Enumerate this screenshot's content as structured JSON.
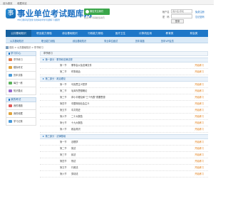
{
  "topbar": {
    "left": "设为首页",
    "right": "收藏本站"
  },
  "header": {
    "logo_glyph": "事",
    "title": "事业单位考试题库网",
    "subtitle": "700万题库每天更新 各类事业单位考试题库下载服务",
    "qr_badge": "微信关注我们",
    "qr_note": "关注公众号获取更多资讯",
    "login": {
      "user_label": "帐户名",
      "user_placeholder": "用户名/手机",
      "pass_label": "密　码",
      "pass_placeholder": "",
      "register_link": "免费注册",
      "forgot_link": "忘记密码",
      "login_button": "登录"
    }
  },
  "nav": [
    "公共基础知识",
    "职业能力测验",
    "综合基础知识",
    "行政能力测验",
    "医疗卫生",
    "计算机应用",
    "教育类",
    "财会类"
  ],
  "subnav": [
    "公共基础知识",
    "职业能力测验",
    "综合基础知识",
    "事业单位面试",
    "历年真题",
    "历年VIP会员"
  ],
  "breadcrumb": "首页 > 公共基础知识 > 章节练习",
  "sidebar": {
    "study_title": "学习中心",
    "study_items": [
      "章节练习",
      "模拟考试",
      "历年试卷",
      "每日一练",
      "知识要点"
    ],
    "exam_title": "我的考试",
    "exam_items": [
      "我的错题",
      "我的收藏",
      "学习记录"
    ]
  },
  "main": {
    "header": "章节练习",
    "chapters": [
      {
        "title": "第一部分 · 董事和法律法规",
        "rows": [
          {
            "sec": "第一节",
            "title": "董事会以及法律文件",
            "action": "开始练习"
          },
          {
            "sec": "第二节",
            "title": "时事政治",
            "action": "开始练习"
          }
        ]
      },
      {
        "title": "第二部分 · 政治理论",
        "rows": [
          {
            "sec": "第一节",
            "title": "马克思主义哲学",
            "action": "开始练习"
          },
          {
            "sec": "第二节",
            "title": "毛泽东思想概论",
            "action": "开始练习"
          },
          {
            "sec": "第三节",
            "title": "邓小平理论和\"三个代表\"重要思想",
            "action": "开始练习"
          },
          {
            "sec": "第四节",
            "title": "中国特色社会主义",
            "action": "开始练习"
          },
          {
            "sec": "第五节",
            "title": "中共党史",
            "action": "开始练习"
          },
          {
            "sec": "第六节",
            "title": "二十大报告",
            "action": "开始练习"
          },
          {
            "sec": "第七节",
            "title": "十九大报告",
            "action": "开始练习"
          },
          {
            "sec": "第八节",
            "title": "政治常识",
            "action": "开始练习"
          }
        ]
      },
      {
        "title": "第三部分 · 法律基础",
        "rows": [
          {
            "sec": "第一节",
            "title": "法理学",
            "action": "开始练习"
          },
          {
            "sec": "第二节",
            "title": "宪法",
            "action": "开始练习"
          },
          {
            "sec": "第三节",
            "title": "民法",
            "action": "开始练习"
          },
          {
            "sec": "第四节",
            "title": "刑法",
            "action": "开始练习"
          },
          {
            "sec": "第五节",
            "title": "行政法",
            "action": "开始练习"
          },
          {
            "sec": "第六节",
            "title": "劳动法",
            "action": "开始练习"
          }
        ]
      }
    ]
  },
  "colors": {
    "brand": "#1e77c8",
    "accent": "#e07a12",
    "wechat": "#3aa64a"
  },
  "icons": [
    "home-icon",
    "wechat-icon",
    "chevron-right-icon"
  ]
}
